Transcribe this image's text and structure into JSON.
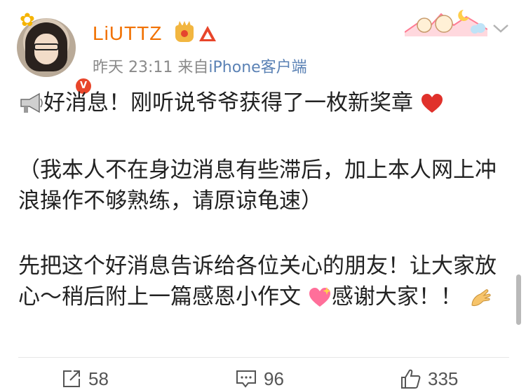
{
  "post": {
    "author": "LiUTTZ",
    "time": "昨天 23:11",
    "source_prefix": "来自",
    "source": "iPhone客户端",
    "paragraphs": [
      "好消息！刚听说爷爷获得了一枚新奖章",
      "（我本人不在身边消息有些滞后，加上本人网上冲浪操作不够熟练，请原谅龟速）",
      "先把这个好消息告诉给各位关心的朋友！让大家放心～稍后附上一篇感恩小作文",
      "感谢大家！！"
    ],
    "icons": {
      "lead": "megaphone-icon",
      "heart": "red-heart-icon",
      "pink_heart": "sparkling-heart-icon",
      "hands": "ok-hand-icon"
    }
  },
  "actions": {
    "repost": "58",
    "comment": "96",
    "like": "335"
  },
  "colors": {
    "username": "#f17100",
    "source": "#5b82b5",
    "meta": "#8a8a8a",
    "text": "#222222"
  }
}
